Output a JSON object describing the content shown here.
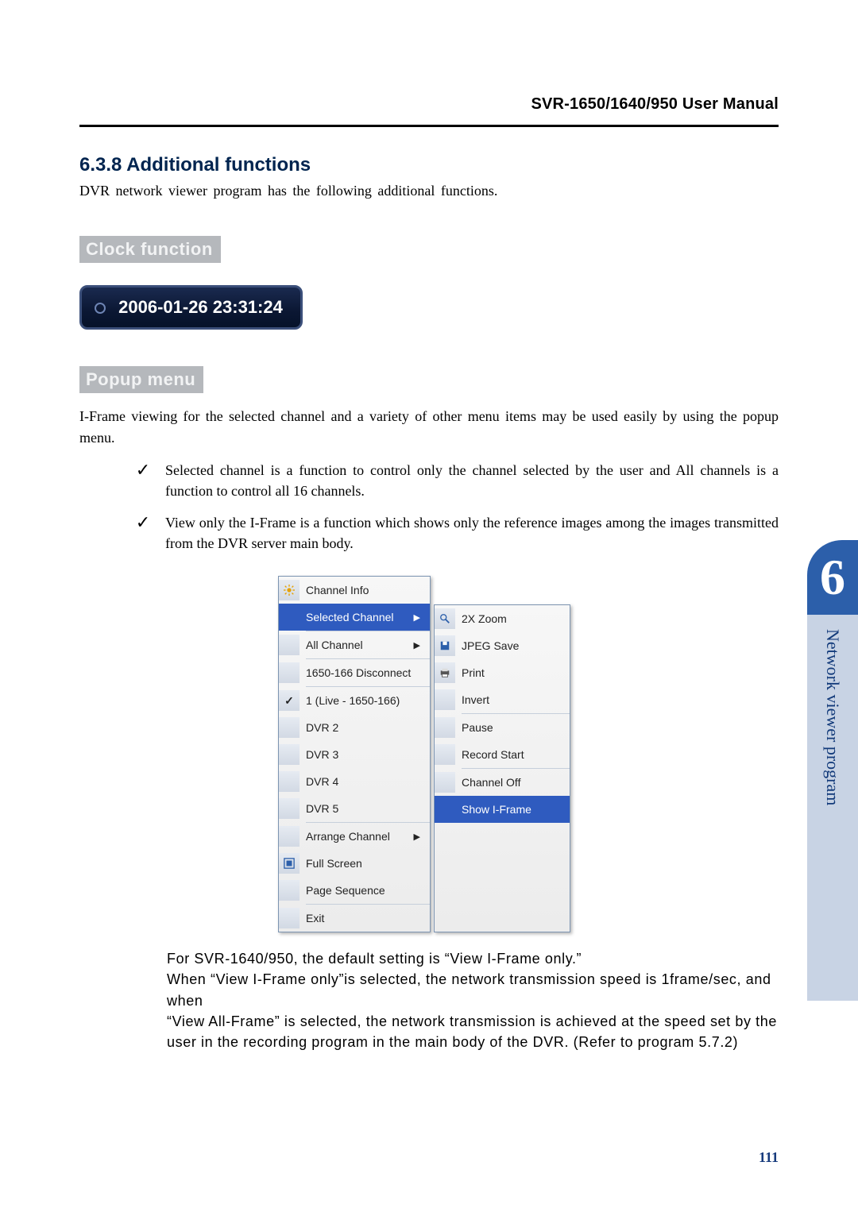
{
  "header": {
    "title": "SVR-1650/1640/950 User Manual"
  },
  "section": {
    "number_title": "6.3.8 Additional functions",
    "intro": "DVR  network  viewer  program  has  the  following  additional  functions."
  },
  "clock": {
    "label": "Clock function",
    "value": "2006-01-26  23:31:24"
  },
  "popup": {
    "label": "Popup menu",
    "para": "I-Frame  viewing  for  the  selected  channel  and  a  variety  of  other  menu  items  may  be  used  easily  by using  the  popup  menu.",
    "bullets": [
      "Selected  channel  is  a  function  to  control  only  the  channel  selected  by  the  user  and  All channels is a function to control all 16 channels.",
      "View only the I-Frame is a function which shows only the reference images among the images transmitted from the DVR server main body."
    ],
    "menu": {
      "items": [
        {
          "label": "Channel Info",
          "icon": "sun-icon"
        },
        {
          "label": "Selected Channel",
          "highlight": true,
          "arrow": true
        },
        {
          "label": "All Channel",
          "arrow": true
        },
        {
          "label": "1650-166 Disconnect"
        },
        {
          "label": "1 (Live - 1650-166)",
          "check": true
        },
        {
          "label": "DVR 2"
        },
        {
          "label": "DVR 3"
        },
        {
          "label": "DVR 4"
        },
        {
          "label": "DVR 5"
        },
        {
          "label": "Arrange Channel",
          "arrow": true
        },
        {
          "label": "Full Screen",
          "icon": "fullscreen-icon"
        },
        {
          "label": "Page Sequence"
        },
        {
          "label": "Exit"
        }
      ],
      "submenu": [
        {
          "label": "2X Zoom",
          "icon": "zoom-icon"
        },
        {
          "label": "JPEG Save",
          "icon": "save-icon"
        },
        {
          "label": "Print",
          "icon": "print-icon"
        },
        {
          "label": "Invert"
        },
        {
          "label": "Pause"
        },
        {
          "label": "Record Start"
        },
        {
          "label": "Channel Off"
        },
        {
          "label": "Show I-Frame",
          "highlight": true
        }
      ]
    },
    "note_lines": [
      "For SVR-1640/950, the default setting is “View I-Frame only.”",
      "When “View I-Frame only”is selected, the network transmission speed is 1frame/sec, and when",
      "“View All-Frame” is selected, the network transmission is achieved at the speed set by the user in the recording program in the main body of the DVR. (Refer to program 5.7.2)"
    ]
  },
  "side": {
    "chapter": "6",
    "title": "Network viewer program"
  },
  "page_number": "111",
  "glyphs": {
    "check": "✓",
    "arrow": "▶"
  }
}
